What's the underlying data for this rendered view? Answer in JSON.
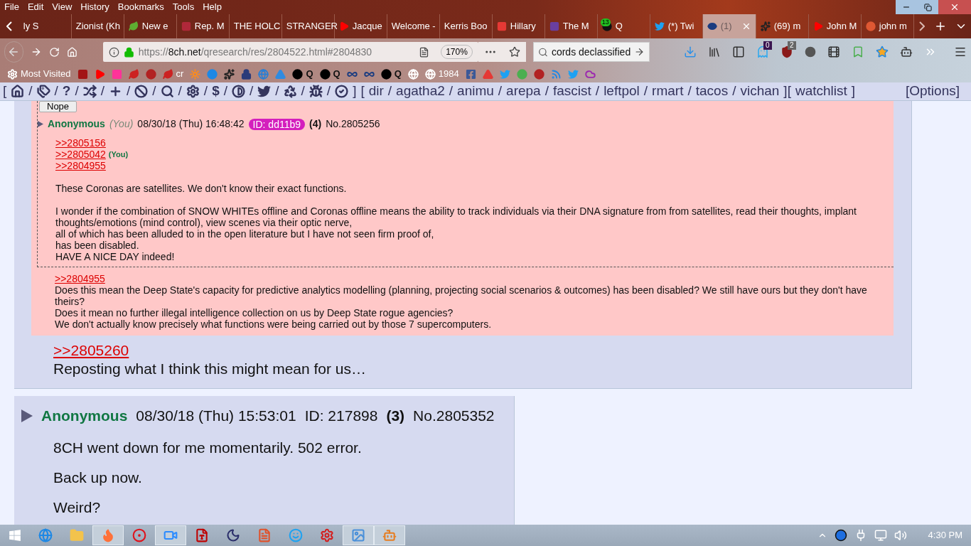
{
  "menu": [
    "File",
    "Edit",
    "View",
    "History",
    "Bookmarks",
    "Tools",
    "Help"
  ],
  "tabs": [
    {
      "title": "ly S",
      "kind": "none",
      "selected": false
    },
    {
      "title": "Zionist (Kh",
      "kind": "none",
      "selected": false
    },
    {
      "title": "New e",
      "kind": "leaf",
      "color": "#5fae32",
      "selected": false
    },
    {
      "title": "Rep. M",
      "kind": "square",
      "color": "#b0283a",
      "selected": false
    },
    {
      "title": "THE HOLC",
      "kind": "none",
      "selected": false
    },
    {
      "title": "STRANGER",
      "kind": "none",
      "selected": false
    },
    {
      "title": "Jacque",
      "kind": "play",
      "color": "#ff0000",
      "selected": false
    },
    {
      "title": "Welcome -",
      "kind": "none",
      "selected": false
    },
    {
      "title": "Kerris Boo",
      "kind": "none",
      "selected": false
    },
    {
      "title": "Hillary",
      "kind": "square",
      "color": "#e53935",
      "selected": false
    },
    {
      "title": "The M",
      "kind": "square",
      "color": "#6a3fa0",
      "selected": false
    },
    {
      "title": "Q",
      "kind": "circle",
      "color": "#111111",
      "badge": "13",
      "selected": false
    },
    {
      "title": "(*) Twi",
      "kind": "bird",
      "color": "#1da1f2",
      "selected": false
    },
    {
      "title": "(1)",
      "kind": "eye",
      "color": "#1a3c80",
      "selected": true
    },
    {
      "title": "(69) m",
      "kind": "star",
      "color": "#222222",
      "selected": false
    },
    {
      "title": "John M",
      "kind": "play",
      "color": "#ff0000",
      "selected": false
    },
    {
      "title": "john m",
      "kind": "circle",
      "color": "#de5833",
      "selected": false
    }
  ],
  "address_bar": {
    "scheme": "https://",
    "domain": "8ch.net",
    "path": "/qresearch/res/2804522.html#2804830",
    "zoom": "170%"
  },
  "search": {
    "value": "cords declassified"
  },
  "toolbar_badges": {
    "ghost": "0",
    "shield": "2"
  },
  "bookmarks": [
    {
      "kind": "gear",
      "color": "#ffffff",
      "label": "Most Visited"
    },
    {
      "kind": "square",
      "color": "#a31515"
    },
    {
      "kind": "play",
      "color": "#ff0000"
    },
    {
      "kind": "square",
      "color": "#ff3399"
    },
    {
      "kind": "leaf",
      "color": "#cc2222"
    },
    {
      "kind": "circle",
      "color": "#b22222"
    },
    {
      "kind": "leaf",
      "color": "#cc2222",
      "label": "cr"
    },
    {
      "kind": "sun",
      "color": "#ff8c1a"
    },
    {
      "kind": "circle",
      "color": "#1e88e5"
    },
    {
      "kind": "star",
      "color": "#222222"
    },
    {
      "kind": "lock",
      "color": "#2a3b7a"
    },
    {
      "kind": "globe",
      "color": "#2a7fd4"
    },
    {
      "kind": "triangle",
      "color": "#2f8be0"
    },
    {
      "kind": "circle",
      "color": "#000000",
      "label": "Q"
    },
    {
      "kind": "circle",
      "color": "#000000",
      "label": "Q"
    },
    {
      "kind": "infinity",
      "color": "#1a3c80"
    },
    {
      "kind": "infinity",
      "color": "#1a3c80"
    },
    {
      "kind": "circle",
      "color": "#000000",
      "label": "Q"
    },
    {
      "kind": "globe",
      "color": "#ffffff"
    },
    {
      "kind": "globe",
      "color": "#ffffff",
      "label": "1984"
    },
    {
      "kind": "facebook",
      "color": "#3b5998"
    },
    {
      "kind": "triangle",
      "color": "#e53935"
    },
    {
      "kind": "bird",
      "color": "#1da1f2"
    },
    {
      "kind": "circle",
      "color": "#4caf50"
    },
    {
      "kind": "circle",
      "color": "#b22222"
    },
    {
      "kind": "rss",
      "color": "#1e88e5"
    },
    {
      "kind": "bird",
      "color": "#1da1f2"
    },
    {
      "kind": "cloud",
      "color": "#9c27b0"
    }
  ],
  "board_nav": {
    "separator": "/",
    "open": "[",
    "close": "]",
    "tools": [
      {
        "kind": "home"
      },
      {
        "kind": "tags"
      },
      {
        "kind": "char",
        "text": "?"
      },
      {
        "kind": "shuffle"
      },
      {
        "kind": "plus"
      },
      {
        "kind": "ban"
      },
      {
        "kind": "search"
      },
      {
        "kind": "gear"
      },
      {
        "kind": "char",
        "text": "$"
      },
      {
        "kind": "contrast"
      },
      {
        "kind": "bird"
      },
      {
        "kind": "recycle"
      },
      {
        "kind": "bug"
      },
      {
        "kind": "check"
      }
    ],
    "boards": [
      "dir",
      "agatha2",
      "animu",
      "arepa",
      "fascist",
      "leftpol",
      "rmart",
      "tacos",
      "vichan"
    ],
    "watchlist": "watchlist",
    "options": "[Options]"
  },
  "thread": {
    "nope_button": "Nope",
    "inline_post": {
      "header": {
        "name": "Anonymous",
        "you": "(You)",
        "date": "08/30/18 (Thu) 16:48:42",
        "id": "ID: dd11b9",
        "replies": "(4)",
        "number": "No.2805256"
      },
      "quotes": [
        {
          "text": ">>2805156"
        },
        {
          "text": ">>2805042",
          "you": "(You)"
        },
        {
          "text": ">>2804955"
        }
      ],
      "paragraphs": [
        [
          "These Coronas are satellites.  We don't know their exact functions."
        ],
        [
          "I wonder if the combination of  SNOW WHITEs offline and Coronas offline means the ability to track individuals via their DNA signature from from satellites, read their thoughts, implant thoughts/emotions (mind control), view scenes via their optic nerve,",
          "all of which has been alluded to in the open literature but I have not seen firm proof of,",
          "has been disabled.",
          "HAVE A NICE DAY indeed!"
        ]
      ]
    },
    "reply_quote": ">>2804955",
    "reply_lines": [
      "Does this mean the Deep State's capacity for predictive analytics modelling (planning, projecting social scenarios & outcomes) has been disabled?  We still have ours but they don't have theirs?",
      "Does it mean no further illegal intelligence collection on us by Deep State rogue agencies?",
      "We don't actually know precisely what functions were being carried out by those 7 supercomputers."
    ],
    "quote": ">>2805260",
    "text": "Reposting what I think this might mean for us…"
  },
  "post": {
    "header": {
      "name": "Anonymous",
      "date": "08/30/18 (Thu) 15:53:01",
      "id": "ID: 217898",
      "replies": "(3)",
      "number": "No.2805352"
    },
    "paragraphs": [
      "8CH went down for me momentarily.  502 error.",
      "Back up now.",
      "Weird?"
    ]
  },
  "taskbar": {
    "apps": [
      {
        "kind": "ie",
        "color": "#1e88e5",
        "open": false
      },
      {
        "kind": "folder",
        "color": "#f3c34c",
        "open": false
      },
      {
        "kind": "firefox",
        "color": "#ff7139",
        "open": true
      },
      {
        "kind": "opera",
        "color": "#e0121b",
        "open": false
      },
      {
        "kind": "video",
        "color": "#2d8cff",
        "open": true
      },
      {
        "kind": "ftp",
        "color": "#bf0000",
        "open": false
      },
      {
        "kind": "moon",
        "color": "#2b2f6b",
        "open": false
      },
      {
        "kind": "doc",
        "color": "#e0522b",
        "open": false
      },
      {
        "kind": "smile",
        "color": "#1fa2f0",
        "open": false
      },
      {
        "kind": "gear",
        "color": "#d42020",
        "open": false
      },
      {
        "kind": "image",
        "color": "#4a90d9",
        "open": true
      },
      {
        "kind": "robot",
        "color": "#e67e22",
        "open": true
      }
    ],
    "clock": "4:30 PM"
  }
}
